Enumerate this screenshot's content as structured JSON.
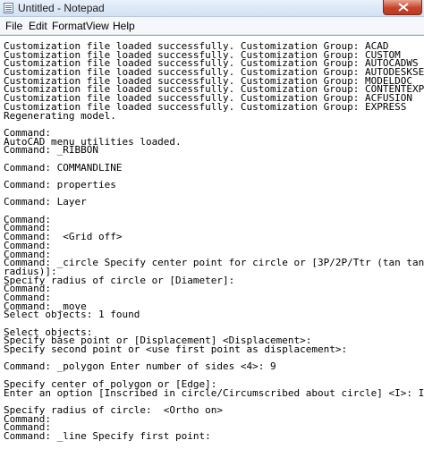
{
  "window": {
    "title": "Untitled - Notepad"
  },
  "menu": [
    "File",
    "Edit",
    "Format",
    "View",
    "Help"
  ],
  "lines": [
    "Customization file loaded successfully. Customization Group: ACAD",
    "Customization file loaded successfully. Customization Group: CUSTOM",
    "Customization file loaded successfully. Customization Group: AUTOCADWS",
    "Customization file loaded successfully. Customization Group: AUTODESKSEEK",
    "Customization file loaded successfully. Customization Group: MODELDOC",
    "Customization file loaded successfully. Customization Group: CONTENTEXPLORER",
    "Customization file loaded successfully. Customization Group: ACFUSION",
    "Customization file loaded successfully. Customization Group: EXPRESS",
    "Regenerating model.",
    "",
    "Command:",
    "AutoCAD menu utilities loaded.",
    "Command: _RIBBON",
    "",
    "Command: COMMANDLINE",
    "",
    "Command: properties",
    "",
    "Command: Layer",
    "",
    "Command:",
    "Command:",
    "Command:  <Grid off>",
    "Command:",
    "Command:",
    "Command: _circle Specify center point for circle or [3P/2P/Ttr (tan tan",
    "radius)]:",
    "Specify radius of circle or [Diameter]:",
    "Command:",
    "Command:",
    "Command: _move",
    "Select objects: 1 found",
    "",
    "Select objects:",
    "Specify base point or [Displacement] <Displacement>:",
    "Specify second point or <use first point as displacement>:",
    "",
    "Command: _polygon Enter number of sides <4>: 9",
    "",
    "Specify center of polygon or [Edge]:",
    "Enter an option [Inscribed in circle/Circumscribed about circle] <I>: I",
    "",
    "Specify radius of circle:  <Ortho on>",
    "Command:",
    "Command:",
    "Command: _line Specify first point:"
  ]
}
